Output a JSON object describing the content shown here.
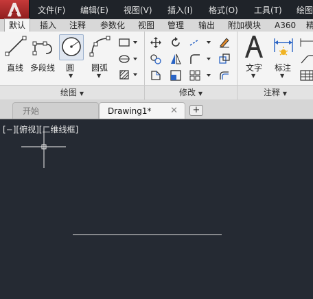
{
  "menu": [
    "文件(F)",
    "编辑(E)",
    "视图(V)",
    "插入(I)",
    "格式(O)",
    "工具(T)",
    "绘图"
  ],
  "ribbon_tabs": [
    "默认",
    "插入",
    "注释",
    "参数化",
    "视图",
    "管理",
    "输出",
    "附加模块",
    "A360",
    "精"
  ],
  "draw_panel": {
    "tools": [
      "直线",
      "多段线",
      "圆",
      "圆弧"
    ],
    "title": "绘图"
  },
  "modify_panel": {
    "title": "修改"
  },
  "annotate_panel": {
    "tools": [
      "文字",
      "标注"
    ],
    "title": "注释"
  },
  "doc_tabs": {
    "start": "开始",
    "active": "Drawing1*",
    "close": "✕",
    "plus": "+"
  },
  "viewport": {
    "label": "[−][俯视][二维线框]"
  },
  "colors": {
    "canvas": "#252a33",
    "menubar": "#1f2329",
    "ribbon": "#f4f4f4",
    "app_button": "#b52b2b",
    "accent_blue": "#2a64c5"
  },
  "icons": [
    "line-icon",
    "polyline-icon",
    "circle-icon",
    "arc-icon",
    "move-icon",
    "rotate-icon",
    "trim-icon",
    "erase-icon",
    "copy-icon",
    "mirror-icon",
    "fillet-icon",
    "explode-icon",
    "stretch-icon",
    "scale-icon",
    "array-icon",
    "offset-icon",
    "text-icon",
    "dimension-icon",
    "table-icon"
  ]
}
